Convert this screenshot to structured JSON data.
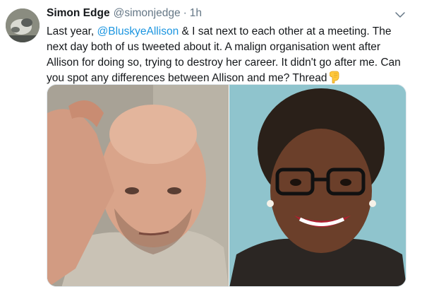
{
  "tweet": {
    "author_name": "Simon Edge",
    "author_handle": "@simonjedge",
    "separator": "·",
    "timestamp": "1h",
    "text_before_mention": "Last year, ",
    "mention": "@BluskyeAllison",
    "text_after_mention": " & I sat next to each other at a meeting. The next day both of us tweeted about it. A malign organisation went after Allison for doing so, trying to destroy her career. It didn't go after me. Can you spot any differences between Allison and me? Thread",
    "emoji": "pointing-down-emoji"
  },
  "icons": {
    "avatar": "profile-photo",
    "menu": "chevron-down-icon"
  },
  "colors": {
    "link": "#1b95e0",
    "secondary_text": "#657786",
    "primary_text": "#14171a"
  },
  "media": {
    "left_photo": "photo-man",
    "right_photo": "photo-woman"
  }
}
